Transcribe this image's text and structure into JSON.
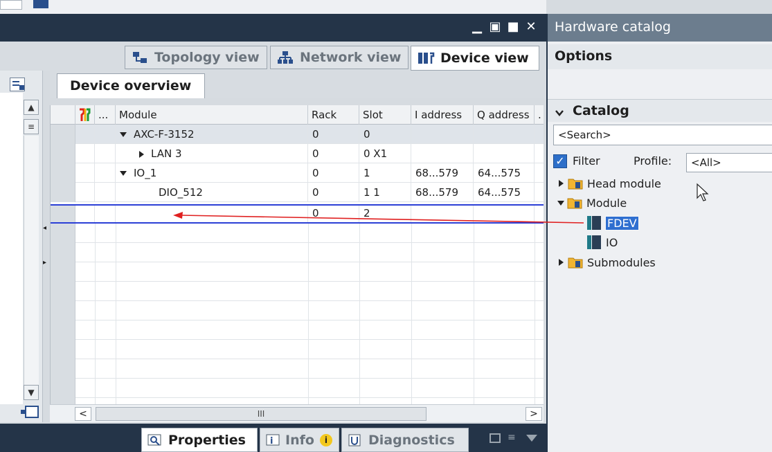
{
  "editor": {
    "tabs": {
      "topology": "Topology view",
      "network": "Network view",
      "device": "Device view"
    },
    "overview_tab": "Device overview",
    "grid": {
      "columns": [
        "Module",
        "Rack",
        "Slot",
        "I address",
        "Q address"
      ],
      "more_col": "...",
      "rows": [
        {
          "module": "AXC-F-3152",
          "rack": "0",
          "slot": "0",
          "i_address": "",
          "q_address": ""
        },
        {
          "module": "LAN 3",
          "rack": "0",
          "slot": "0 X1",
          "i_address": "",
          "q_address": ""
        },
        {
          "module": "IO_1",
          "rack": "0",
          "slot": "1",
          "i_address": "68...579",
          "q_address": "64...575"
        },
        {
          "module": "DIO_512",
          "rack": "0",
          "slot": "1 1",
          "i_address": "68...579",
          "q_address": "64...575"
        },
        {
          "module": "",
          "rack": "0",
          "slot": "2",
          "i_address": "",
          "q_address": ""
        }
      ],
      "scroll_grip": "III"
    },
    "bottom_tabs": {
      "properties": "Properties",
      "info": "Info",
      "diagnostics": "Diagnostics"
    }
  },
  "catalog": {
    "title": "Hardware catalog",
    "options_label": "Options",
    "catalog_label": "Catalog",
    "search_placeholder": "<Search>",
    "filter_label": "Filter",
    "profile_label": "Profile:",
    "profile_value": "<All>",
    "tree": {
      "head_module": "Head module",
      "module": "Module",
      "fdev": "FDEV",
      "io": "IO",
      "submodules": "Submodules"
    }
  },
  "colors": {
    "titlebar": "#243448",
    "catalog_title": "#6c7d8e",
    "selection": "#2f6fd0",
    "drop_line": "#2b3fd6",
    "drag_arrow": "#e02020"
  }
}
